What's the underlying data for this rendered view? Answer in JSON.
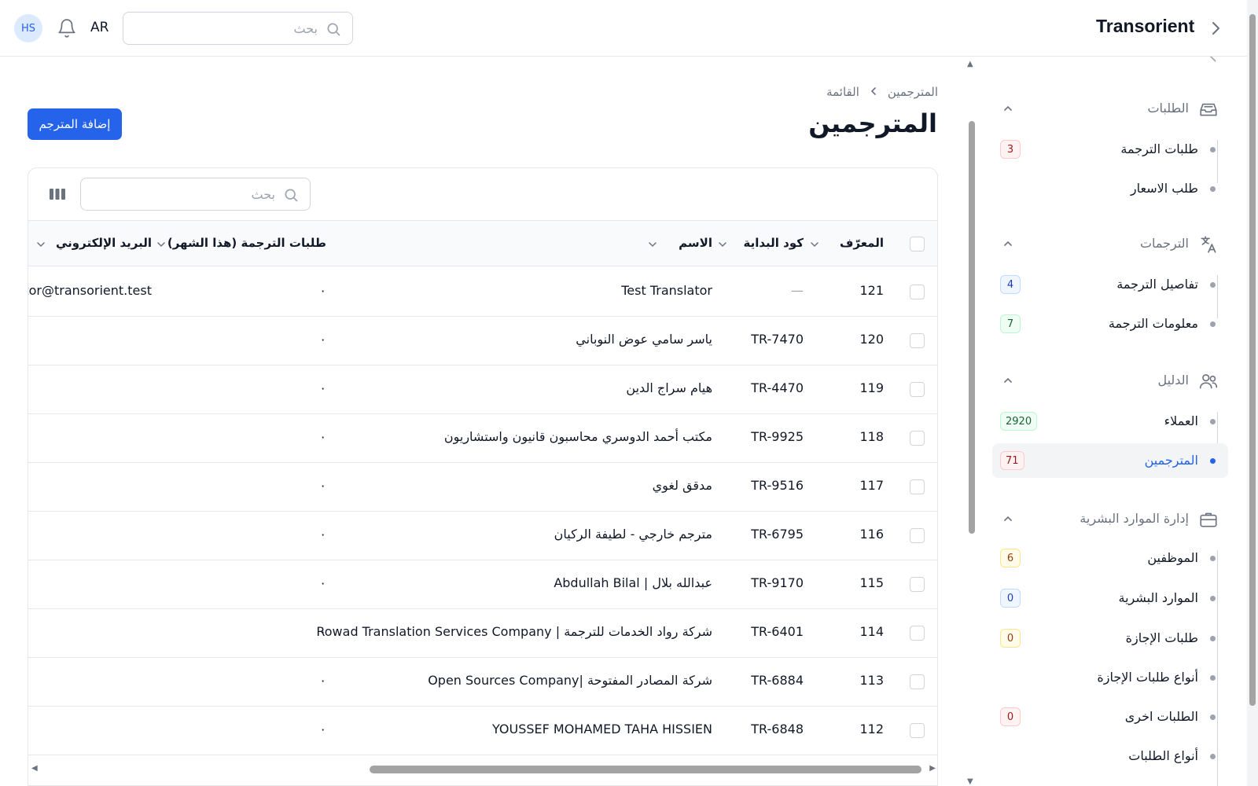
{
  "header": {
    "avatar_initials": "HS",
    "language": "AR",
    "search_placeholder": "بحث",
    "brand": "Transorient"
  },
  "sidebar": {
    "groups": [
      {
        "title": "الطلبات",
        "icon": "inbox-icon",
        "items": [
          {
            "label": "طلبات الترجمة",
            "badge": "3",
            "badge_color": "#991b1b"
          },
          {
            "label": "طلب الاسعار",
            "badge": ""
          }
        ]
      },
      {
        "title": "الترجمات",
        "icon": "translate-icon",
        "items": [
          {
            "label": "تفاصيل الترجمة",
            "badge": "4",
            "badge_color": "#1e40af"
          },
          {
            "label": "معلومات الترجمة",
            "badge": "7",
            "badge_color": "#166534"
          }
        ]
      },
      {
        "title": "الدليل",
        "icon": "users-icon",
        "items": [
          {
            "label": "العملاء",
            "badge": "2920",
            "badge_color": "#166534"
          },
          {
            "label": "المترجمين",
            "badge": "71",
            "badge_color": "#991b1b",
            "active": true
          }
        ]
      },
      {
        "title": "إدارة الموارد البشرية",
        "icon": "briefcase-icon",
        "items": [
          {
            "label": "الموظفين",
            "badge": "6",
            "badge_color": "#92400e"
          },
          {
            "label": "الموارد البشرية",
            "badge": "0",
            "badge_color": "#1e40af"
          },
          {
            "label": "طلبات الإجازة",
            "badge": "0",
            "badge_color": "#92400e"
          },
          {
            "label": "أنواع طلبات الإجازة",
            "badge": ""
          },
          {
            "label": "الطلبات اخرى",
            "badge": "0",
            "badge_color": "#991b1b"
          },
          {
            "label": "أنواع الطلبات",
            "badge": ""
          }
        ]
      }
    ]
  },
  "main": {
    "breadcrumb": [
      "المترجمين",
      "القائمة"
    ],
    "title": "المترجمين",
    "add_button": "إضافة المترجم",
    "table": {
      "search_placeholder": "بحث",
      "columns": {
        "id": "المعرّف",
        "prefix": "كود البداية",
        "name": "الاسم",
        "requests": "طلبات الترجمة (هذا الشهر)",
        "email": "البريد الإلكتروني"
      },
      "rows": [
        {
          "id": "121",
          "prefix": "—",
          "name": "Test Translator",
          "requests": "٠",
          "email": "translator@transorient.test"
        },
        {
          "id": "120",
          "prefix": "TR-7470",
          "name": "ياسر سامي عوض النوباني",
          "requests": "٠",
          "email": ""
        },
        {
          "id": "119",
          "prefix": "TR-4470",
          "name": "هيام سراج الدين",
          "requests": "٠",
          "email": ""
        },
        {
          "id": "118",
          "prefix": "TR-9925",
          "name": "مكتب أحمد الدوسري محاسبون قانيون واستشاريون",
          "requests": "٠",
          "email": ""
        },
        {
          "id": "117",
          "prefix": "TR-9516",
          "name": "مدقق لغوي",
          "requests": "٠",
          "email": ""
        },
        {
          "id": "116",
          "prefix": "TR-6795",
          "name": "مترجم خارجي - لطيفة الركيان",
          "requests": "٠",
          "email": ""
        },
        {
          "id": "115",
          "prefix": "TR-9170",
          "name": "عبدالله بلال | Abdullah Bilal",
          "requests": "٠",
          "email": ""
        },
        {
          "id": "114",
          "prefix": "TR-6401",
          "name": "شركة رواد الخدمات للترجمة | Rowad Translation Services Company",
          "requests": "٠",
          "email": ""
        },
        {
          "id": "113",
          "prefix": "TR-6884",
          "name": "شركة المصادر المفتوحة |Open Sources Company",
          "requests": "٠",
          "email": ""
        },
        {
          "id": "112",
          "prefix": "TR-6848",
          "name": "YOUSSEF MOHAMED TAHA HISSIEN",
          "requests": "٠",
          "email": ""
        }
      ]
    }
  },
  "colors": {
    "accent": "#2563eb",
    "text": "#111827",
    "muted": "#6b7280",
    "border": "#e5e7eb"
  }
}
